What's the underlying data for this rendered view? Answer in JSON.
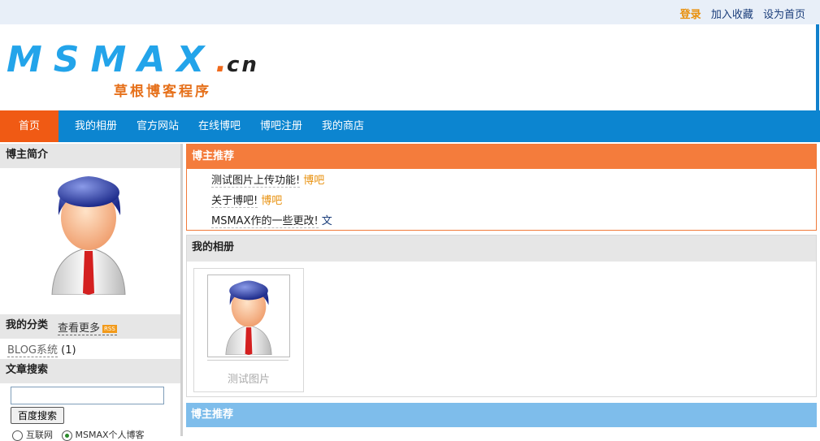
{
  "top_links": {
    "login": "登录",
    "favorite": "加入收藏",
    "homepage": "设为首页"
  },
  "header": {
    "logo_main": "MSMAX",
    "logo_dot": ".",
    "logo_suffix": "cn",
    "slogan": "草根博客程序"
  },
  "nav": {
    "items": [
      "首页",
      "我的相册",
      "官方网站",
      "在线博吧",
      "博吧注册",
      "我的商店"
    ]
  },
  "sidebar": {
    "intro_title": "博主简介",
    "see_more": "查看更多",
    "rss_badge": "RSS",
    "category_title": "我的分类",
    "categories": [
      {
        "name": "BLOG系统",
        "count": "(1)"
      }
    ],
    "search_title": "文章搜索",
    "search_value": "",
    "search_button": "百度搜索",
    "radio_options": [
      "互联网",
      "MSMAX个人博客"
    ]
  },
  "recommend": {
    "title": "博主推荐",
    "items": [
      {
        "title": "测试图片上传功能!",
        "category": "博吧"
      },
      {
        "title": "关于博吧!",
        "category": "博吧"
      },
      {
        "title": "MSMAX作的一些更改!",
        "category": "文"
      }
    ]
  },
  "album": {
    "title": "我的相册",
    "photos": [
      {
        "caption": "测试图片"
      }
    ]
  },
  "recommend2": {
    "title": "博主推荐"
  },
  "colors": {
    "accent": "#f47c3c",
    "nav_bg": "#0c85d0",
    "home_tab": "#f05a14",
    "link_orange": "#e8900c"
  }
}
